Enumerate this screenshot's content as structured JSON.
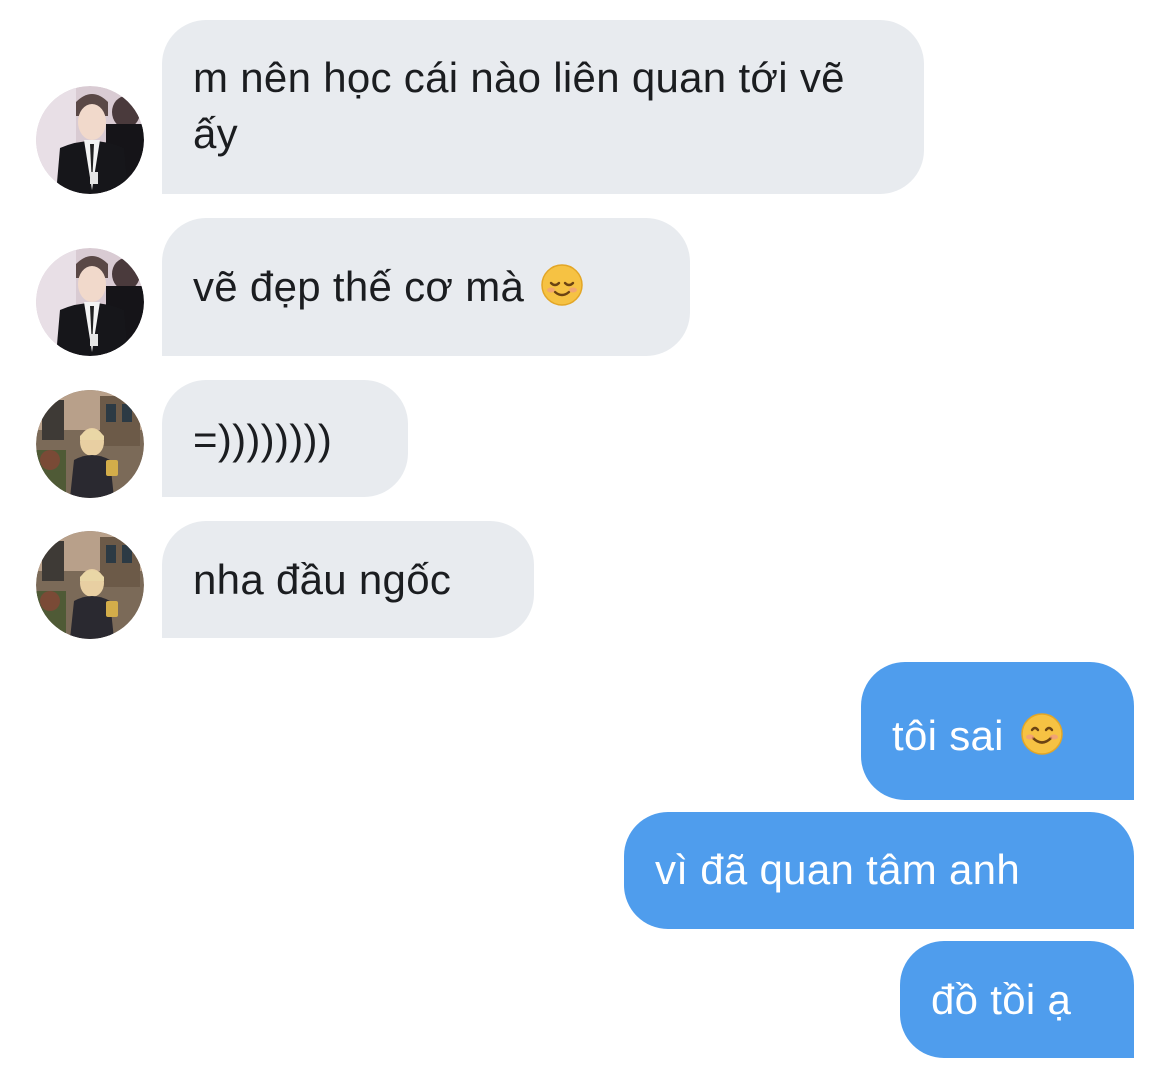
{
  "conversation": {
    "messages": [
      {
        "sender": "other",
        "avatar": "avatar-suit-boy",
        "text": "m nên học cái nào liên quan tới vẽ ấy"
      },
      {
        "sender": "other",
        "avatar": "avatar-suit-boy",
        "text": "vẽ đẹp thế cơ mà",
        "emoji": "relieved-face-icon"
      },
      {
        "sender": "other",
        "avatar": "avatar-street-boy",
        "text": "=))))))))"
      },
      {
        "sender": "other",
        "avatar": "avatar-street-boy",
        "text": "nha đầu ngốc"
      },
      {
        "sender": "me",
        "text": "tôi sai",
        "emoji": "smiling-face-icon"
      },
      {
        "sender": "me",
        "text": "vì đã quan tâm anh"
      },
      {
        "sender": "me",
        "text": "đồ tồi ạ"
      }
    ]
  },
  "colors": {
    "incoming_bubble": "#e8ebef",
    "incoming_text": "#1b1d20",
    "outgoing_bubble": "#4f9ded",
    "outgoing_text": "#ffffff",
    "background": "#ffffff"
  }
}
